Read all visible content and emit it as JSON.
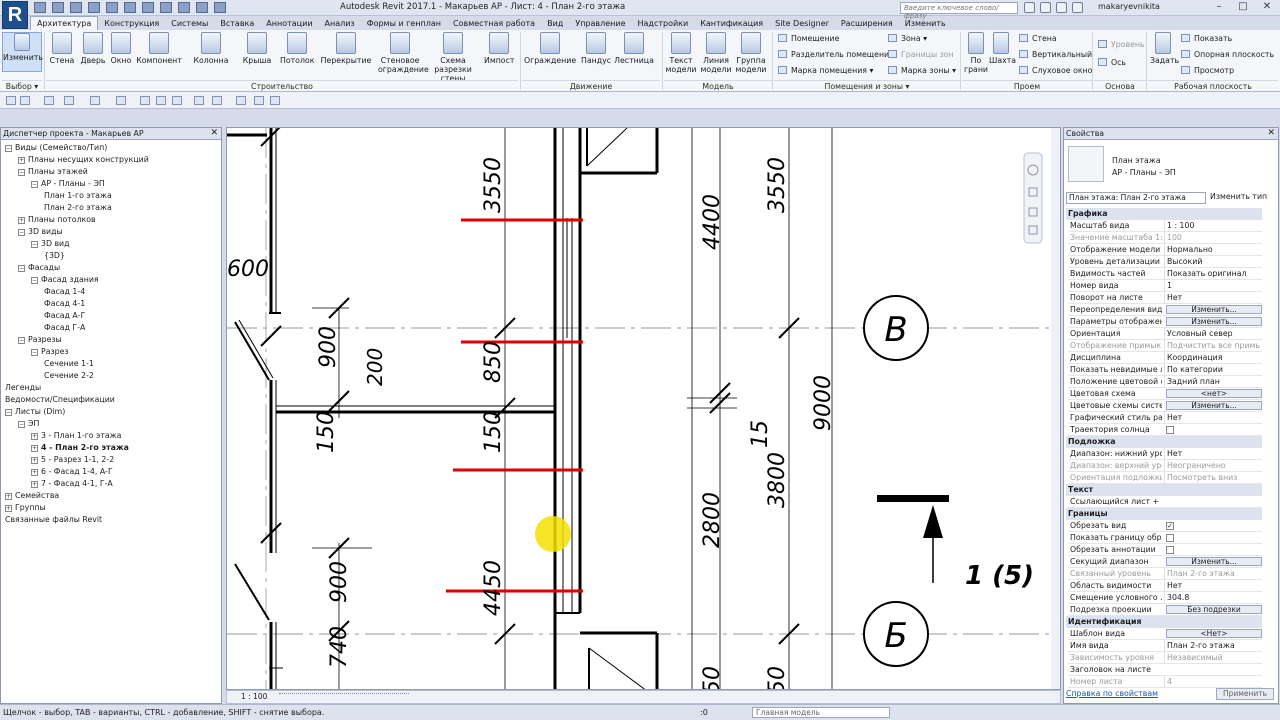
{
  "app": {
    "logo": "R",
    "title": "Autodesk Revit 2017.1 -    Макарьев АР - Лист: 4 - План 2-го этажа",
    "search_placeholder": "Введите ключевое слово/фразу",
    "user": "makaryevnikita"
  },
  "tabs": [
    "Архитектура",
    "Конструкция",
    "Системы",
    "Вставка",
    "Аннотации",
    "Анализ",
    "Формы и генплан",
    "Совместная работа",
    "Вид",
    "Управление",
    "Надстройки",
    "Кантификация",
    "Site Designer",
    "Расширения",
    "Изменить"
  ],
  "ribbon": {
    "modify": "Изменить",
    "select": "Выбор ▾",
    "build": [
      "Стена",
      "Дверь",
      "Окно",
      "Компонент",
      "Колонна",
      "Крыша",
      "Потолок",
      "Перекрытие",
      "Стеновое ограждение",
      "Схема разрезки стены",
      "Импост"
    ],
    "build_group": "Строительство",
    "move": [
      "Ограждение",
      "Пандус",
      "Лестница"
    ],
    "move_group": "Движение",
    "model": [
      "Текст модели",
      "Линия модели",
      "Группа модели"
    ],
    "model_group": "Модель",
    "rooms": [
      "Помещение",
      "Разделитель помещений",
      "Марка помещения ▾",
      "Зона ▾",
      "Границы зон",
      "Марка зоны ▾"
    ],
    "rooms_group": "Помещения и зоны ▾",
    "opening": [
      "По грани",
      "Шахта",
      "Стена",
      "Вертикальный",
      "Слуховое окно"
    ],
    "opening_group": "Проем",
    "datum": [
      "Уровень",
      "Ось"
    ],
    "datum_group": "Основа",
    "workplane": [
      "Задать",
      "Показать",
      "Опорная плоскость",
      "Просмотр"
    ],
    "workplane_group": "Рабочая плоскость"
  },
  "browser": {
    "title": "Диспетчер проекта - Макарьев АР",
    "items": [
      {
        "t": "Виды (Семейство/Тип)",
        "lvl": 0,
        "tog": "-"
      },
      {
        "t": "Планы несущих конструкций",
        "lvl": 1,
        "tog": "+"
      },
      {
        "t": "Планы этажей",
        "lvl": 1,
        "tog": "-"
      },
      {
        "t": "АР - Планы - ЭП",
        "lvl": 2,
        "tog": "-"
      },
      {
        "t": "План 1-го этажа",
        "lvl": 3,
        "tog": ""
      },
      {
        "t": "План 2-го этажа",
        "lvl": 3,
        "tog": ""
      },
      {
        "t": "Планы потолков",
        "lvl": 1,
        "tog": "+"
      },
      {
        "t": "3D виды",
        "lvl": 1,
        "tog": "-"
      },
      {
        "t": "3D вид",
        "lvl": 2,
        "tog": "-"
      },
      {
        "t": "{3D}",
        "lvl": 3,
        "tog": ""
      },
      {
        "t": "Фасады",
        "lvl": 1,
        "tog": "-"
      },
      {
        "t": "Фасад здания",
        "lvl": 2,
        "tog": "-"
      },
      {
        "t": "Фасад 1-4",
        "lvl": 3,
        "tog": ""
      },
      {
        "t": "Фасад 4-1",
        "lvl": 3,
        "tog": ""
      },
      {
        "t": "Фасад А-Г",
        "lvl": 3,
        "tog": ""
      },
      {
        "t": "Фасад Г-А",
        "lvl": 3,
        "tog": ""
      },
      {
        "t": "Разрезы",
        "lvl": 1,
        "tog": "-"
      },
      {
        "t": "Разрез",
        "lvl": 2,
        "tog": "-"
      },
      {
        "t": "Сечение 1-1",
        "lvl": 3,
        "tog": ""
      },
      {
        "t": "Сечение 2-2",
        "lvl": 3,
        "tog": ""
      },
      {
        "t": "Легенды",
        "lvl": 0,
        "tog": ""
      },
      {
        "t": "Ведомости/Спецификации",
        "lvl": 0,
        "tog": ""
      },
      {
        "t": "Листы (Dim)",
        "lvl": 0,
        "tog": "-"
      },
      {
        "t": "ЭП",
        "lvl": 1,
        "tog": "-"
      },
      {
        "t": "3 - План 1-го этажа",
        "lvl": 2,
        "tog": "+"
      },
      {
        "t": "4 - План 2-го этажа",
        "lvl": 2,
        "tog": "+",
        "bold": true
      },
      {
        "t": "5 - Разрез 1-1, 2-2",
        "lvl": 2,
        "tog": "+"
      },
      {
        "t": "6 - Фасад 1-4, А-Г",
        "lvl": 2,
        "tog": "+"
      },
      {
        "t": "7 - Фасад 4-1, Г-А",
        "lvl": 2,
        "tog": "+"
      },
      {
        "t": "Семейства",
        "lvl": 0,
        "tog": "+"
      },
      {
        "t": "Группы",
        "lvl": 0,
        "tog": "+"
      },
      {
        "t": "Связанные файлы Revit",
        "lvl": 0,
        "tog": ""
      }
    ]
  },
  "drawing": {
    "dims": [
      "600",
      "3550",
      "4400",
      "3550",
      "900",
      "200",
      "850",
      "150",
      "150",
      "15",
      "3800",
      "9000",
      "2800",
      "900",
      "4450",
      "740",
      "50",
      "50"
    ],
    "grid": [
      "В",
      "Б"
    ],
    "section": "1 (5)"
  },
  "view_scale": "1 : 100",
  "props": {
    "title": "Свойства",
    "family": "План этажа",
    "type": "АР - Планы - ЭП",
    "selector": "План этажа: План 2-го этажа",
    "edit_type": "Изменить тип",
    "help": "Справка по свойствам",
    "apply": "Применить",
    "rows": [
      {
        "s": "Графика"
      },
      {
        "k": "Масштаб вида",
        "v": "1 : 100"
      },
      {
        "k": "Значение масштаба    1:",
        "v": "100",
        "d": true
      },
      {
        "k": "Отображение модели",
        "v": "Нормально"
      },
      {
        "k": "Уровень детализации",
        "v": "Высокий"
      },
      {
        "k": "Видимость частей",
        "v": "Показать оригинал"
      },
      {
        "k": "Номер вида",
        "v": "1"
      },
      {
        "k": "Поворот на листе",
        "v": "Нет"
      },
      {
        "k": "Переопределения види...",
        "b": "Изменить..."
      },
      {
        "k": "Параметры отображен...",
        "b": "Изменить..."
      },
      {
        "k": "Ориентация",
        "v": "Условный север"
      },
      {
        "k": "Отображение примык...",
        "v": "Подчистить все примык...",
        "d": true
      },
      {
        "k": "Дисциплина",
        "v": "Координация"
      },
      {
        "k": "Показать невидимые л...",
        "v": "По категории"
      },
      {
        "k": "Положение цветовой с...",
        "v": "Задний план"
      },
      {
        "k": "Цветовая схема",
        "b": "<нет>"
      },
      {
        "k": "Цветовые схемы систе...",
        "b": "Изменить..."
      },
      {
        "k": "Графический стиль ра...",
        "v": "Нет"
      },
      {
        "k": "Траектория солнца",
        "c": ""
      },
      {
        "s": "Подложка"
      },
      {
        "k": "Диапазон: нижний уро...",
        "v": "Нет"
      },
      {
        "k": "Диапазон: верхний уро...",
        "v": "Неограничено",
        "d": true
      },
      {
        "k": "Ориентация подложки",
        "v": "Посмотреть вниз",
        "d": true
      },
      {
        "s": "Текст"
      },
      {
        "k": "Ссылающийся лист +",
        "v": ""
      },
      {
        "s": "Границы"
      },
      {
        "k": "Обрезать вид",
        "c": "✓"
      },
      {
        "k": "Показать границу обре...",
        "c": ""
      },
      {
        "k": "Обрезать аннотации",
        "c": ""
      },
      {
        "k": "Секущий диапазон",
        "b": "Изменить..."
      },
      {
        "k": "Связанный уровень",
        "v": "План 2-го этажа",
        "d": true
      },
      {
        "k": "Область видимости",
        "v": "Нет"
      },
      {
        "k": "Смещение условного ...",
        "v": "304.8"
      },
      {
        "k": "Подрезка проекции",
        "b": "Без подрезки"
      },
      {
        "s": "Идентификация"
      },
      {
        "k": "Шаблон вида",
        "b": "<Нет>"
      },
      {
        "k": "Имя вида",
        "v": "План 2-го этажа"
      },
      {
        "k": "Зависимость уровня",
        "v": "Независимый",
        "d": true
      },
      {
        "k": "Заголовок на листе",
        "v": ""
      },
      {
        "k": "Номер листа",
        "v": "4",
        "d": true
      }
    ]
  },
  "status": {
    "hint": "Щелчок - выбор, TAB - варианты, CTRL - добавление, SHIFT - снятие выбора.",
    "zero": ":0",
    "model": "Главная модель"
  }
}
